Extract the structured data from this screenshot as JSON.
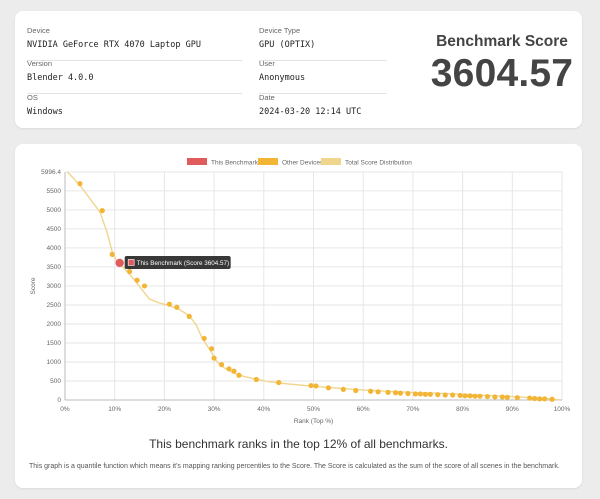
{
  "info": {
    "device": {
      "label": "Device",
      "value": "NVIDIA GeForce RTX 4070 Laptop GPU"
    },
    "device_type": {
      "label": "Device Type",
      "value": "GPU (OPTIX)"
    },
    "version": {
      "label": "Version",
      "value": "Blender 4.0.0"
    },
    "user": {
      "label": "User",
      "value": "Anonymous"
    },
    "os": {
      "label": "OS",
      "value": "Windows"
    },
    "date": {
      "label": "Date",
      "value": "2024-03-20 12:14 UTC"
    }
  },
  "score": {
    "title": "Benchmark Score",
    "value": "3604.57"
  },
  "rank_text": "This benchmark ranks in the top 12% of all benchmarks.",
  "description": "This graph is a quantile function which means it's mapping ranking percentiles to the Score. The Score is calculated as the sum of the score of all scenes in the benchmark.",
  "colors": {
    "this": "#e05c5c",
    "other": "#f2b536",
    "dist": "#f0d58c"
  },
  "chart_data": {
    "type": "line",
    "xlabel": "Rank (Top %)",
    "ylabel": "Score",
    "xlim": [
      0,
      100
    ],
    "ylim": [
      0,
      5996.4
    ],
    "x_ticks": [
      "0%",
      "10%",
      "20%",
      "30%",
      "40%",
      "50%",
      "60%",
      "70%",
      "80%",
      "90%",
      "100%"
    ],
    "y_ticks": [
      "0",
      "500",
      "1000",
      "1500",
      "2000",
      "2500",
      "3000",
      "3500",
      "4000",
      "4500",
      "5000",
      "5500",
      "5996.4"
    ],
    "legend": [
      "This Benchmark",
      "Other Devices",
      "Total Score Distribution"
    ],
    "legend_position": "top",
    "distribution": {
      "name": "Total Score Distribution",
      "x": [
        0.5,
        3,
        5,
        7,
        8.5,
        9.5,
        10.5,
        11.5,
        12.5,
        14,
        15.5,
        17,
        19,
        21,
        23,
        25,
        26.5,
        27.5,
        28.5,
        29.5,
        30,
        31,
        32,
        34,
        36,
        38,
        41,
        45,
        50,
        55,
        60,
        65,
        70,
        75,
        80,
        85,
        90,
        95,
        98,
        99.5
      ],
      "y": [
        5996,
        5650,
        5300,
        4950,
        4400,
        3900,
        3620,
        3520,
        3380,
        3150,
        2900,
        2650,
        2550,
        2480,
        2380,
        2220,
        1950,
        1650,
        1450,
        1250,
        1100,
        950,
        850,
        700,
        620,
        560,
        480,
        420,
        360,
        310,
        260,
        230,
        200,
        180,
        150,
        120,
        90,
        55,
        30,
        5
      ]
    },
    "other_devices": {
      "name": "Other Devices",
      "x": [
        3,
        7.5,
        9.5,
        13,
        14.5,
        16,
        21,
        22.5,
        25,
        28,
        29.5,
        30,
        31.5,
        33,
        34,
        35,
        38.5,
        43,
        49.5,
        50.5,
        53,
        56,
        58.5,
        61.5,
        63,
        65,
        66.5,
        67.5,
        69,
        70.5,
        71.5,
        72.5,
        73.5,
        75,
        76.5,
        78,
        79.5,
        80.5,
        81.5,
        82.5,
        83.5,
        85,
        86.5,
        88,
        89,
        91,
        93.5,
        94.5,
        95.5,
        96.5,
        98
      ],
      "y": [
        5690,
        4980,
        3830,
        3380,
        3150,
        3000,
        2520,
        2440,
        2200,
        1620,
        1350,
        1100,
        930,
        820,
        760,
        650,
        540,
        460,
        380,
        370,
        320,
        280,
        250,
        230,
        215,
        200,
        190,
        180,
        170,
        160,
        160,
        150,
        150,
        140,
        130,
        130,
        120,
        110,
        110,
        100,
        100,
        90,
        80,
        80,
        70,
        60,
        50,
        40,
        30,
        30,
        20
      ]
    },
    "this_benchmark": {
      "name": "This Benchmark",
      "x": 11,
      "y": 3604.57,
      "tooltip": "This Benchmark (Score 3604.57)"
    }
  }
}
